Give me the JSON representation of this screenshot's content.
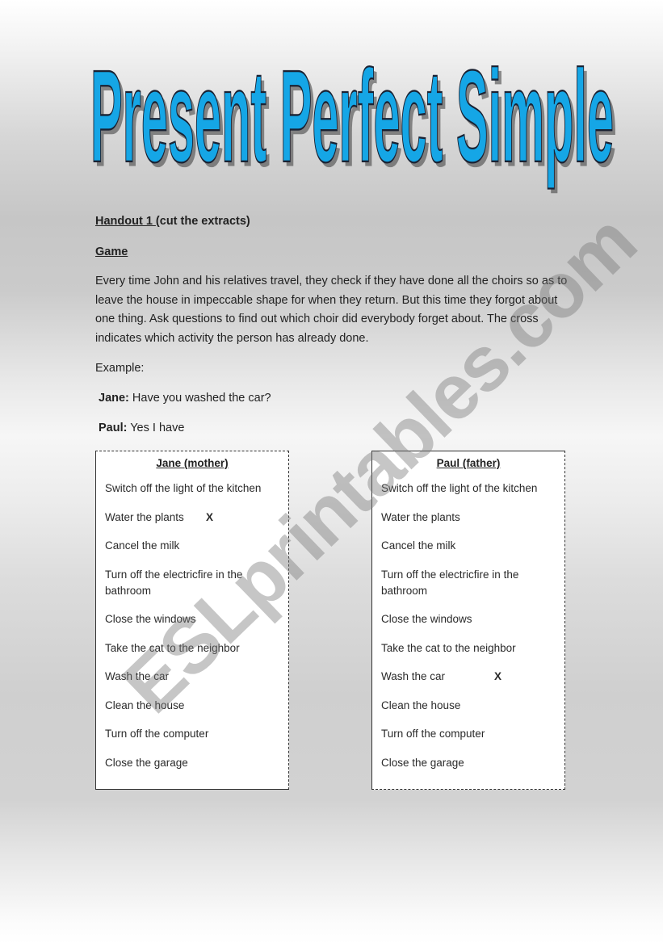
{
  "title": "Present Perfect Simple",
  "handout": {
    "label": "Handout 1 ",
    "note": "(cut the extracts)"
  },
  "section_heading": "Game",
  "instructions": "Every time John and his relatives travel, they check if they have done all the choirs so as to leave the house in impeccable shape for when they return. But this time they forgot about one thing. Ask questions to find out which choir did everybody forget about. The cross indicates which activity the person has already done.",
  "example": {
    "label": "Example:",
    "lines": [
      {
        "speaker": "Jane:",
        "text": " Have you washed the car?"
      },
      {
        "speaker": "Paul:",
        "text": " Yes I have"
      }
    ]
  },
  "cards": [
    {
      "title": "Jane (mother)",
      "items": [
        {
          "text": "Switch off the light of the kitchen",
          "mark": ""
        },
        {
          "text": "Water the plants",
          "mark": "X"
        },
        {
          "text": "Cancel the milk",
          "mark": ""
        },
        {
          "text": "Turn off the electricfire in the bathroom",
          "mark": ""
        },
        {
          "text": "Close the windows",
          "mark": ""
        },
        {
          "text": "Take the cat to the neighbor",
          "mark": ""
        },
        {
          "text": "Wash the car",
          "mark": ""
        },
        {
          "text": "Clean the house",
          "mark": ""
        },
        {
          "text": "Turn off the computer",
          "mark": ""
        },
        {
          "text": "Close the garage",
          "mark": ""
        }
      ]
    },
    {
      "title": "Paul (father)",
      "items": [
        {
          "text": "Switch off the light of the kitchen",
          "mark": ""
        },
        {
          "text": "Water the plants",
          "mark": ""
        },
        {
          "text": "Cancel the milk",
          "mark": ""
        },
        {
          "text": "Turn off the electricfire in the bathroom",
          "mark": ""
        },
        {
          "text": "Close the windows",
          "mark": ""
        },
        {
          "text": "Take the cat to the neighbor",
          "mark": ""
        },
        {
          "text": "Wash the car",
          "mark": "X"
        },
        {
          "text": "Clean the house",
          "mark": ""
        },
        {
          "text": "Turn off the computer",
          "mark": ""
        },
        {
          "text": "Close the garage",
          "mark": ""
        }
      ]
    }
  ],
  "watermark": "ESLprintables.com",
  "colors": {
    "title_fill": "#15a6e6",
    "title_outline": "#1a2233"
  }
}
